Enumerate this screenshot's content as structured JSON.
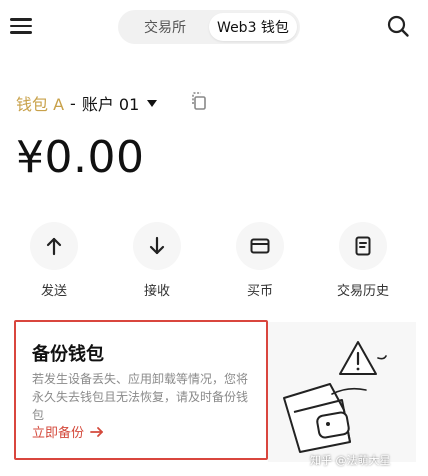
{
  "topbar": {
    "tabs": [
      {
        "label": "交易所",
        "active": false
      },
      {
        "label": "Web3 钱包",
        "active": true
      }
    ]
  },
  "wallet": {
    "name": "钱包 A",
    "separator": "-",
    "account": "账户 01"
  },
  "balance": "¥0.00",
  "actions": [
    {
      "label": "发送",
      "icon": "arrow-up-icon"
    },
    {
      "label": "接收",
      "icon": "arrow-down-icon"
    },
    {
      "label": "买币",
      "icon": "card-icon"
    },
    {
      "label": "交易历史",
      "icon": "history-icon"
    }
  ],
  "backup_card": {
    "title": "备份钱包",
    "description": "若发生设备丢失、应用卸载等情况，您将永久失去钱包且无法恢复，请及时备份钱包",
    "link_label": "立即备份",
    "highlight_color": "#d9463e"
  },
  "watermark": "知乎 @法萌大星",
  "colors": {
    "wallet_name": "#c8a14a",
    "link": "#d44a3c"
  }
}
